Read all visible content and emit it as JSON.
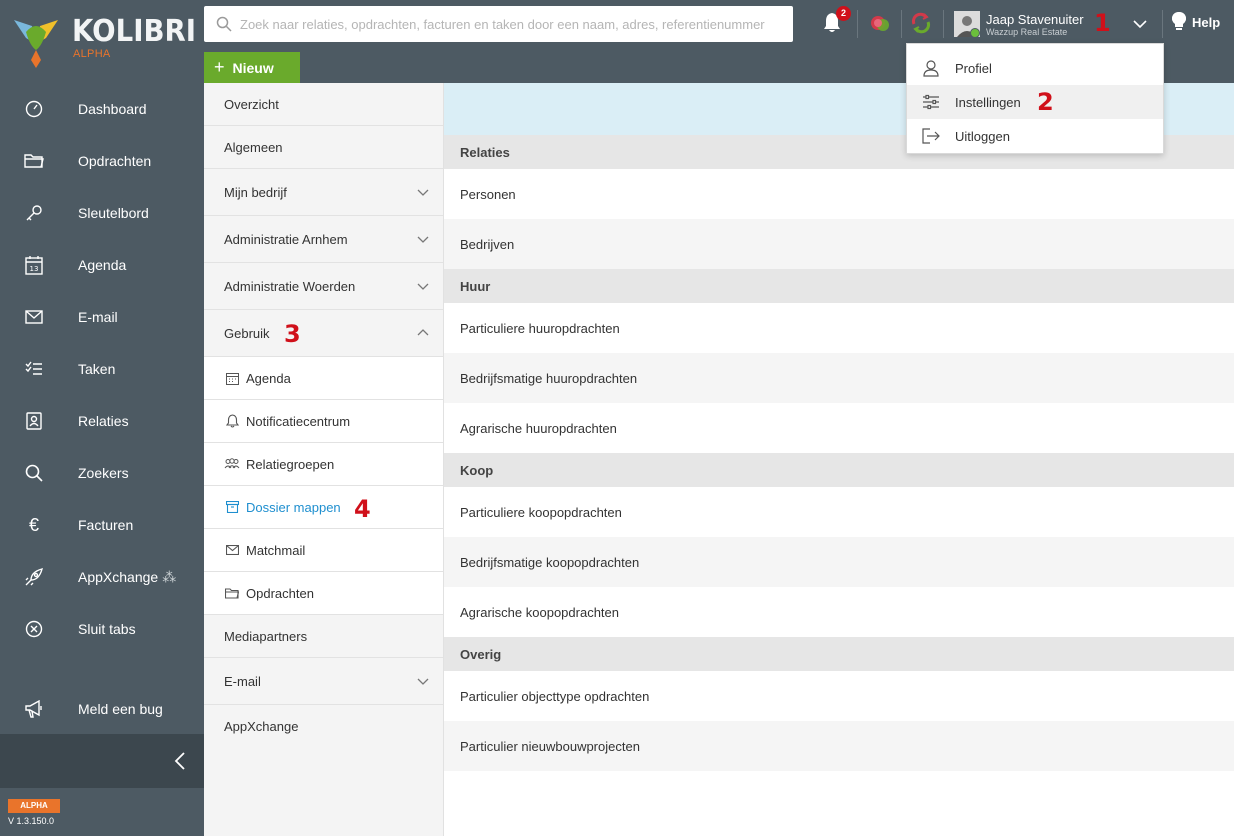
{
  "app": {
    "brand": "KOLIBRI",
    "brand_sub": "ALPHA",
    "version_badge": "ALPHA",
    "version": "V 1.3.150.0"
  },
  "sidebar": {
    "items": [
      {
        "label": "Dashboard",
        "icon": "dashboard-icon"
      },
      {
        "label": "Opdrachten",
        "icon": "folder-icon"
      },
      {
        "label": "Sleutelbord",
        "icon": "key-icon"
      },
      {
        "label": "Agenda",
        "icon": "calendar-icon"
      },
      {
        "label": "E-mail",
        "icon": "mail-icon"
      },
      {
        "label": "Taken",
        "icon": "tasks-icon"
      },
      {
        "label": "Relaties",
        "icon": "contact-icon"
      },
      {
        "label": "Zoekers",
        "icon": "search-icon"
      },
      {
        "label": "Facturen",
        "icon": "euro-icon"
      },
      {
        "label": "AppXchange",
        "icon": "rocket-icon"
      },
      {
        "label": "Sluit tabs",
        "icon": "close-circle-icon"
      }
    ],
    "bug_label": "Meld een bug"
  },
  "topbar": {
    "search_placeholder": "Zoek naar relaties, opdrachten, facturen en taken door een naam, adres, referentienummer",
    "new_label": "Nieuw",
    "notification_count": "2",
    "user_name": "Jaap Stavenuiter",
    "user_company": "Wazzup Real Estate",
    "help_label": "Help"
  },
  "steps": {
    "one": "1",
    "two": "2",
    "three": "3",
    "four": "4"
  },
  "user_menu": {
    "items": [
      "Profiel",
      "Instellingen",
      "Uitloggen"
    ]
  },
  "subnav": {
    "items": [
      "Overzicht",
      "Algemeen",
      "Mijn bedrijf",
      "Administratie Arnhem",
      "Administratie Woerden",
      "Gebruik"
    ],
    "children": [
      "Agenda",
      "Notificatiecentrum",
      "Relatiegroepen",
      "Dossier mappen",
      "Matchmail",
      "Opdrachten"
    ],
    "after": [
      "Mediapartners",
      "E-mail",
      "AppXchange"
    ]
  },
  "main": {
    "sections": [
      {
        "title": "Relaties",
        "rows": [
          "Personen",
          "Bedrijven"
        ]
      },
      {
        "title": "Huur",
        "rows": [
          "Particuliere huuropdrachten",
          "Bedrijfsmatige huuropdrachten",
          "Agrarische huuropdrachten"
        ]
      },
      {
        "title": "Koop",
        "rows": [
          "Particuliere koopopdrachten",
          "Bedrijfsmatige koopopdrachten",
          "Agrarische koopopdrachten"
        ]
      },
      {
        "title": "Overig",
        "rows": [
          "Particulier objecttype opdrachten",
          "Particulier nieuwbouwprojecten"
        ]
      }
    ]
  },
  "colors": {
    "sidebar": "#4d5a63",
    "accent_green": "#6aaa2c",
    "accent_orange": "#e9742b",
    "link_blue": "#1f8fcf",
    "annotation_red": "#d0101a",
    "banner": "#daeef6"
  }
}
